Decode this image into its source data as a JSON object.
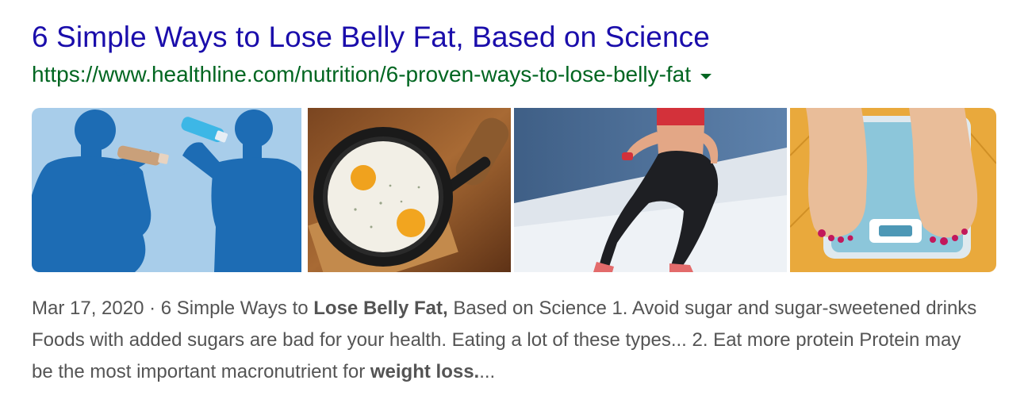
{
  "result": {
    "title": "6 Simple Ways to Lose Belly Fat, Based on Science",
    "url": "https://www.healthline.com/nutrition/6-proven-ways-to-lose-belly-fat",
    "images": [
      {
        "icon": "silhouettes-drinking-image"
      },
      {
        "icon": "eggs-in-skillet-image"
      },
      {
        "icon": "woman-running-image"
      },
      {
        "icon": "feet-on-scale-image"
      }
    ],
    "snippet": {
      "date": "Mar 17, 2020",
      "separator": " · ",
      "part1": "6 Simple Ways to ",
      "bold1": "Lose Belly Fat,",
      "part2": " Based on Science 1. Avoid sugar and sugar-sweetened drinks Foods with added sugars are bad for your health. Eating a lot of these types... 2. Eat more protein Protein may be the most important macronutrient for ",
      "bold2": "weight loss.",
      "ellipsis": "..."
    }
  },
  "colors": {
    "title": "#1a0dab",
    "url": "#006621",
    "snippet": "#545454"
  }
}
